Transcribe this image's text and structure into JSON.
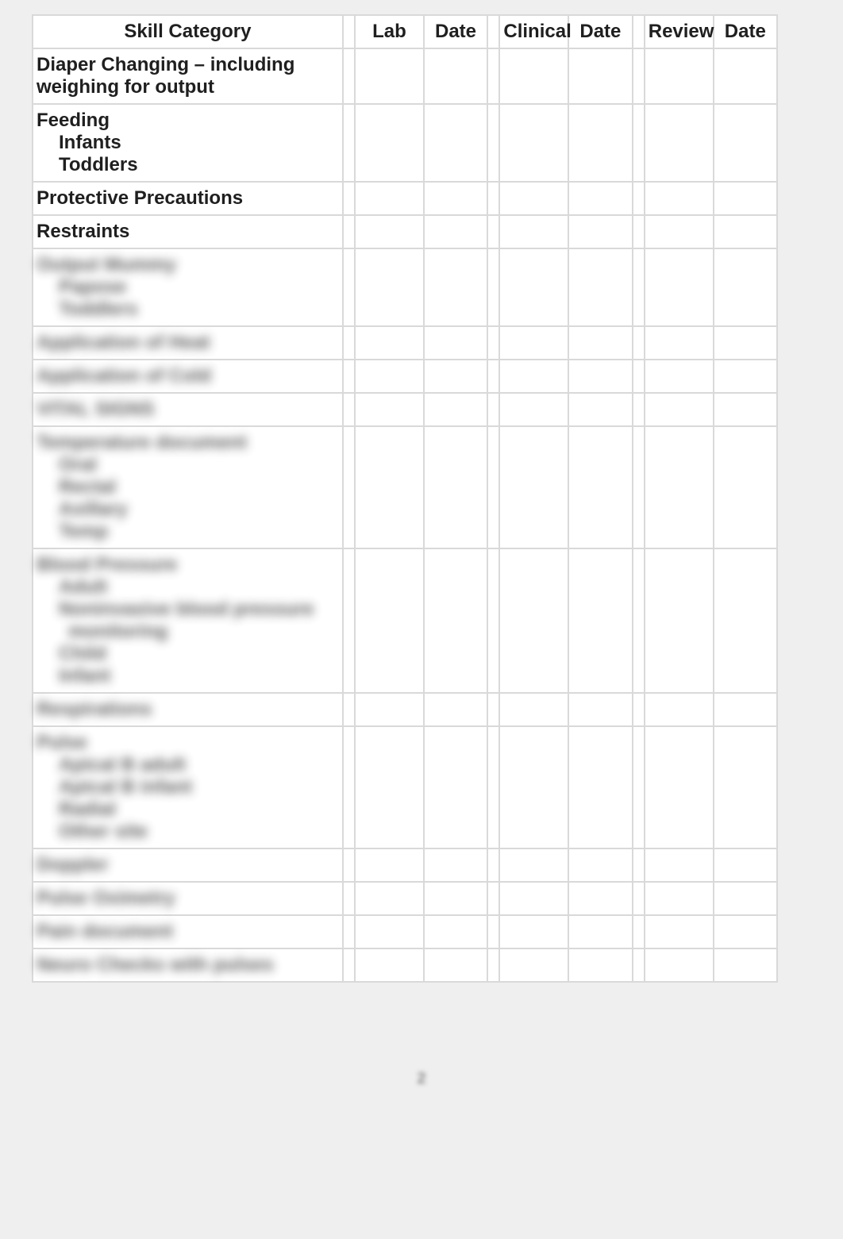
{
  "headers": {
    "skill": "Skill Category",
    "lab": "Lab",
    "date1": "Date",
    "clinical": "Clinical",
    "date2": "Date",
    "review": "Review",
    "date3": "Date"
  },
  "rows": [
    {
      "id": "diaper-changing",
      "blur": false,
      "lines": [
        {
          "text": "Diaper Changing – including",
          "indent": 0
        },
        {
          "text": "weighing for output",
          "indent": 0
        }
      ]
    },
    {
      "id": "feeding",
      "blur": false,
      "lines": [
        {
          "text": "Feeding",
          "indent": 0
        },
        {
          "text": "Infants",
          "indent": 1
        },
        {
          "text": "Toddlers",
          "indent": 1
        }
      ]
    },
    {
      "id": "protective-precautions",
      "blur": false,
      "lines": [
        {
          "text": "Protective Precautions",
          "indent": 0
        }
      ]
    },
    {
      "id": "restraints",
      "blur": false,
      "lines": [
        {
          "text": "Restraints",
          "indent": 0
        }
      ]
    },
    {
      "id": "output-mummy",
      "blur": true,
      "lines": [
        {
          "text": "Output Mummy",
          "indent": 0
        },
        {
          "text": "Papose",
          "indent": 1
        },
        {
          "text": "Toddlers",
          "indent": 1
        }
      ]
    },
    {
      "id": "application-of-heat",
      "blur": true,
      "lines": [
        {
          "text": "Application of Heat",
          "indent": 0
        }
      ]
    },
    {
      "id": "application-of-cold",
      "blur": true,
      "lines": [
        {
          "text": "Application of Cold",
          "indent": 0
        }
      ]
    },
    {
      "id": "vital-signs",
      "blur": true,
      "lines": [
        {
          "text": "VITAL SIGNS",
          "indent": 0
        }
      ]
    },
    {
      "id": "temperature",
      "blur": true,
      "lines": [
        {
          "text": "Temperature document",
          "indent": 0
        },
        {
          "text": "Oral",
          "indent": 1
        },
        {
          "text": "Rectal",
          "indent": 1
        },
        {
          "text": "Axillary",
          "indent": 1
        },
        {
          "text": "Temp",
          "indent": 1
        }
      ]
    },
    {
      "id": "blood-pressure",
      "blur": true,
      "lines": [
        {
          "text": "Blood Pressure",
          "indent": 0
        },
        {
          "text": "Adult",
          "indent": 1
        },
        {
          "text": "Noninvasive blood pressure",
          "indent": 1
        },
        {
          "text": "monitoring",
          "indent": 2
        },
        {
          "text": "Child",
          "indent": 1
        },
        {
          "text": "Infant",
          "indent": 1
        }
      ]
    },
    {
      "id": "respirations",
      "blur": true,
      "lines": [
        {
          "text": "Respirations",
          "indent": 0
        }
      ]
    },
    {
      "id": "pulse",
      "blur": true,
      "lines": [
        {
          "text": "Pulse",
          "indent": 0
        },
        {
          "text": "Apical B adult",
          "indent": 1
        },
        {
          "text": "Apical B infant",
          "indent": 1
        },
        {
          "text": "Radial",
          "indent": 1
        },
        {
          "text": "Other site",
          "indent": 1
        }
      ]
    },
    {
      "id": "doppler",
      "blur": true,
      "lines": [
        {
          "text": "Doppler",
          "indent": 0
        }
      ]
    },
    {
      "id": "pulse-oximetry",
      "blur": true,
      "lines": [
        {
          "text": "Pulse Oximetry",
          "indent": 0
        }
      ]
    },
    {
      "id": "pulse-document",
      "blur": true,
      "lines": [
        {
          "text": "Pain document",
          "indent": 0
        }
      ]
    },
    {
      "id": "neuro-checks",
      "blur": true,
      "lines": [
        {
          "text": "Neuro Checks with pulses",
          "indent": 0
        }
      ]
    }
  ],
  "page_number": "2"
}
